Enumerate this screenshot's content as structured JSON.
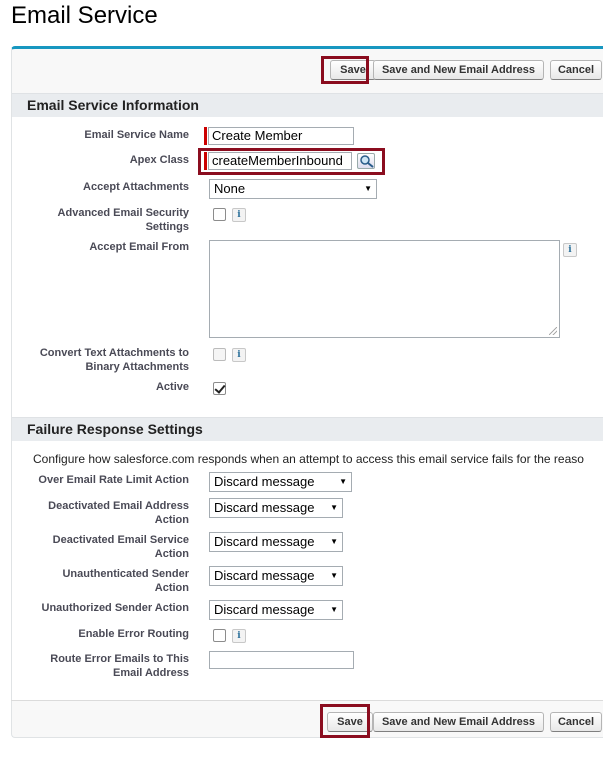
{
  "page": {
    "title": "Email Service"
  },
  "buttons": {
    "save": "Save",
    "save_and_new": "Save and New Email Address",
    "cancel": "Cancel"
  },
  "info_section": {
    "title": "Email Service Information",
    "email_service_name": {
      "label": "Email Service Name",
      "value": "Create Member"
    },
    "apex_class": {
      "label": "Apex Class",
      "value": "createMemberInbound",
      "lookup_icon": "search-lookup-icon"
    },
    "accept_attachments": {
      "label": "Accept Attachments",
      "value": "None"
    },
    "advanced_security": {
      "label_1": "Advanced Email Security",
      "label_2": "Settings",
      "checked": false
    },
    "accept_email_from": {
      "label": "Accept Email From",
      "value": ""
    },
    "convert_text": {
      "label_1": "Convert Text Attachments to",
      "label_2": "Binary Attachments",
      "checked": false
    },
    "active": {
      "label": "Active",
      "checked": true
    }
  },
  "failure_section": {
    "title": "Failure Response Settings",
    "description": "Configure how salesforce.com responds when an attempt to access this email service fails for the reaso",
    "over_rate_limit": {
      "label": "Over Email Rate Limit Action",
      "value": "Discard message"
    },
    "deactivated_address": {
      "label_1": "Deactivated Email Address",
      "label_2": "Action",
      "value": "Discard message"
    },
    "deactivated_service": {
      "label_1": "Deactivated Email Service",
      "label_2": "Action",
      "value": "Discard message"
    },
    "unauthenticated_sender": {
      "label_1": "Unauthenticated Sender",
      "label_2": "Action",
      "value": "Discard message"
    },
    "unauthorized_sender": {
      "label": "Unauthorized Sender Action",
      "value": "Discard message"
    },
    "enable_error_routing": {
      "label": "Enable Error Routing",
      "checked": false
    },
    "route_error_emails": {
      "label_1": "Route Error Emails to This",
      "label_2": "Email Address",
      "value": ""
    }
  },
  "colors": {
    "highlight": "#8b0d1f",
    "panel_top_border": "#1797c0",
    "required": "#cc0000",
    "section_header_bg": "#e9ecef"
  }
}
